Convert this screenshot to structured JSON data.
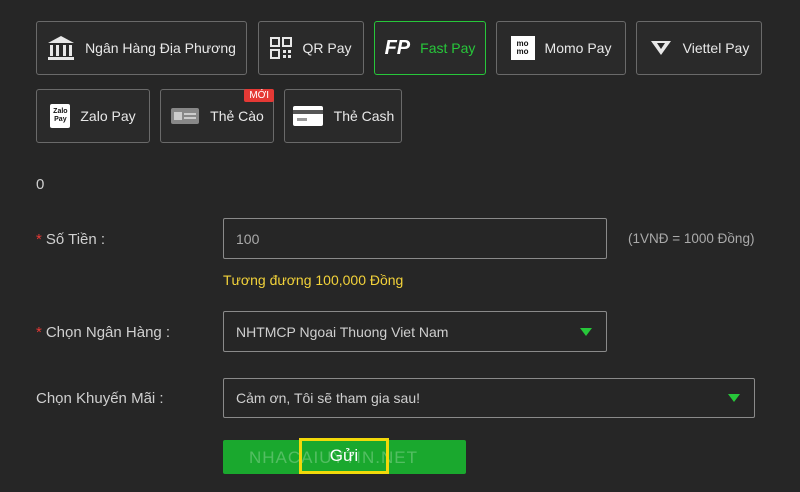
{
  "methods": [
    {
      "label": "Ngân Hàng Địa Phương",
      "icon": "bank-icon"
    },
    {
      "label": "QR Pay",
      "icon": "qr-code-icon"
    },
    {
      "label": "Fast Pay",
      "icon": "fastpay-logo-icon",
      "logo_text": "FP"
    },
    {
      "label": "Momo Pay",
      "icon": "momo-logo-icon",
      "logo_text": "mo mo"
    },
    {
      "label": "Viettel Pay",
      "icon": "viettel-pay-logo-icon"
    },
    {
      "label": "Zalo Pay",
      "icon": "zalo-pay-logo-icon",
      "logo_text": "Zalo Pay"
    },
    {
      "label": "Thẻ Cào",
      "icon": "scratch-card-icon",
      "badge": "MỚI"
    },
    {
      "label": "Thẻ Cash",
      "icon": "cash-card-icon"
    }
  ],
  "active_method": "Fast Pay",
  "zero_text": "0",
  "form": {
    "amount": {
      "required": "*",
      "label": "Số Tiền :",
      "value": "100",
      "hint": "(1VNĐ = 1000 Đồng)",
      "equivalent": "Tương đương 100,000 Đồng"
    },
    "bank": {
      "required": "*",
      "label": "Chọn Ngân Hàng :",
      "value": "NHTMCP Ngoai Thuong Viet Nam"
    },
    "promo": {
      "label": "Chọn Khuyến Mãi :",
      "value": "Cảm ơn, Tôi sẽ tham gia sau!"
    },
    "submit_label": "Gửi",
    "watermark": "NHACAIUYTIN.NET"
  },
  "colors": {
    "accent": "#27c73a",
    "highlight": "#f2d90a",
    "equivalent_text": "#f2d23a",
    "required": "#e53935"
  }
}
